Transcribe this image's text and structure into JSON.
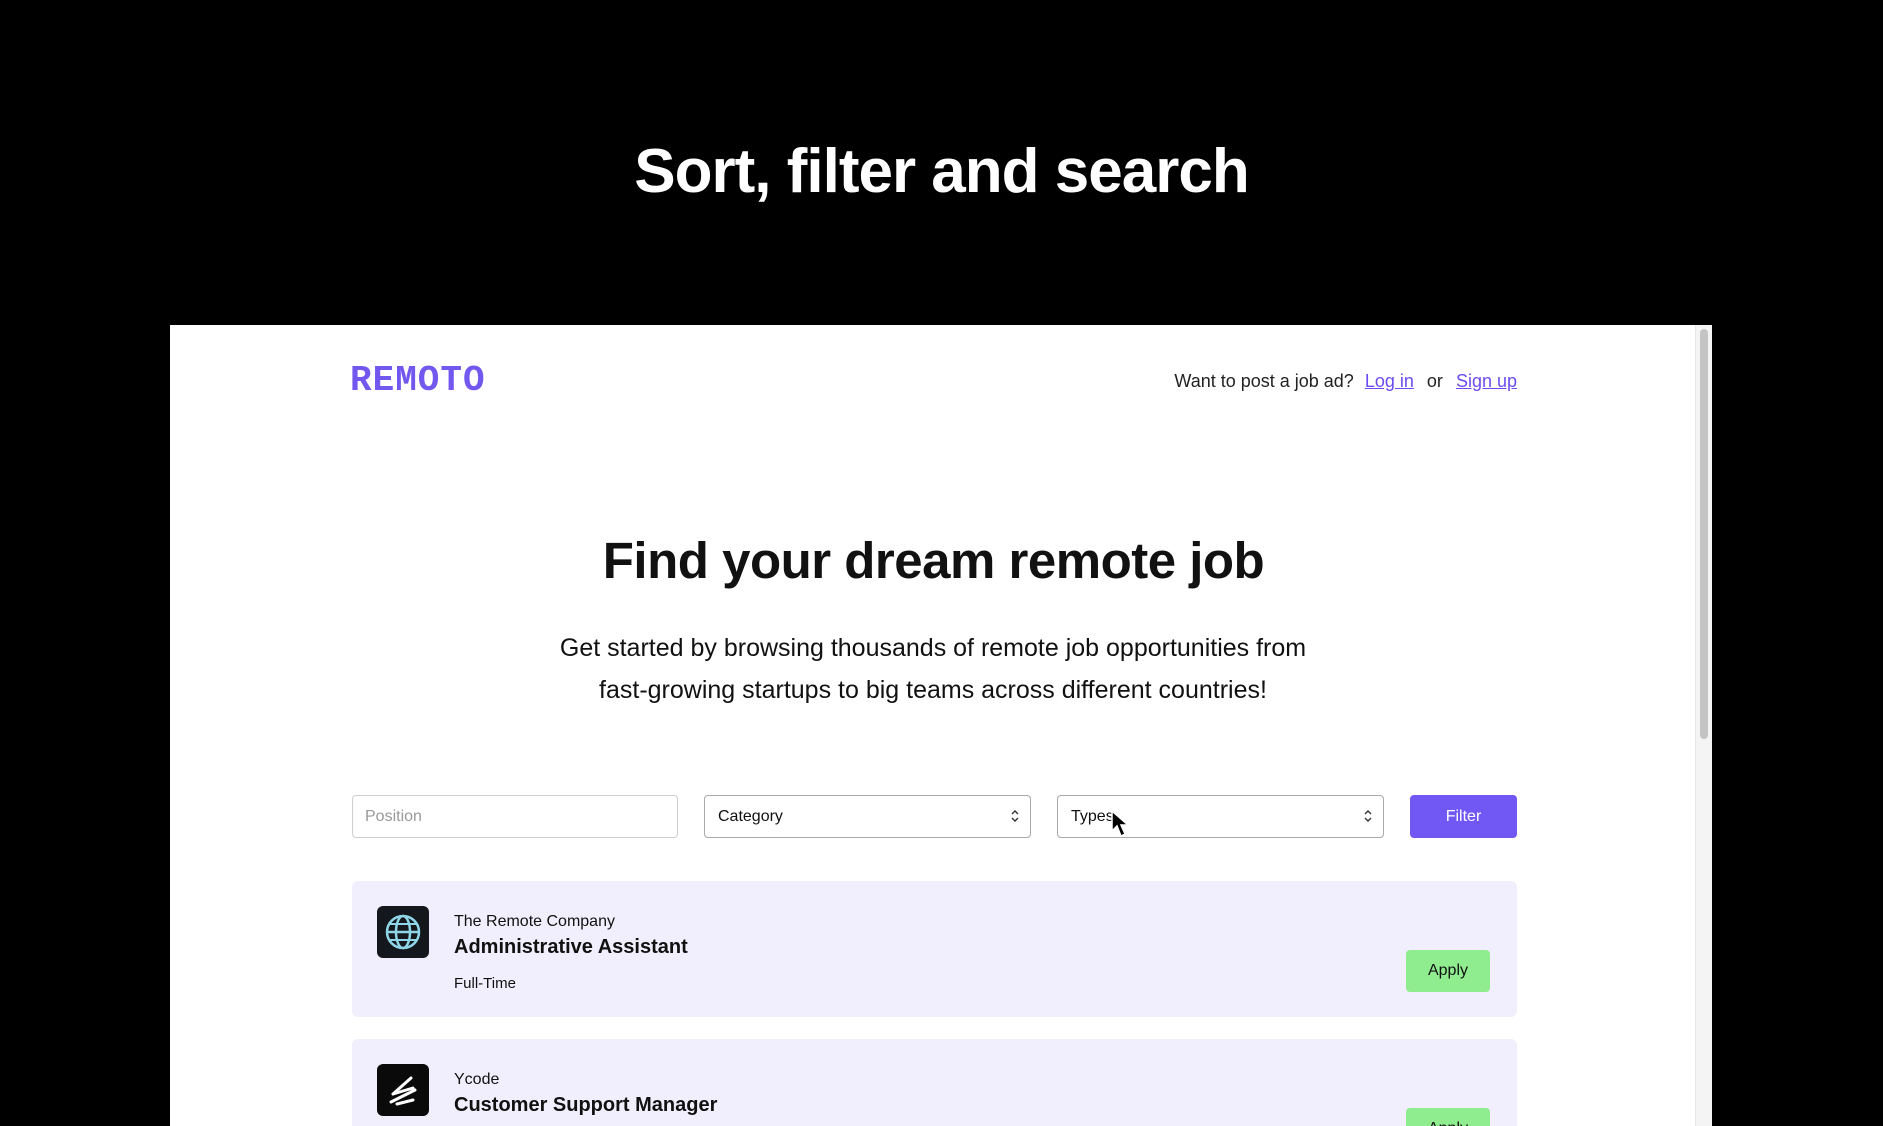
{
  "headline": "Sort, filter and search",
  "site": {
    "logo": "REMOTO",
    "auth_prompt": "Want to post a job ad?",
    "login_label": "Log in",
    "or_label": "or",
    "signup_label": "Sign up"
  },
  "hero": {
    "title": "Find your dream remote job",
    "subtitle": "Get started by browsing thousands of remote job opportunities from fast-growing startups to big teams across different countries!"
  },
  "filters": {
    "position_placeholder": "Position",
    "category_value": "Category",
    "types_value": "Types",
    "filter_label": "Filter"
  },
  "jobs": [
    {
      "company": "The Remote Company",
      "title": "Administrative Assistant",
      "type": "Full-Time",
      "apply_label": "Apply",
      "logo_icon": "globe-icon"
    },
    {
      "company": "Ycode",
      "title": "Customer Support Manager",
      "type": "",
      "apply_label": "Apply",
      "logo_icon": "ycode-logo-icon"
    }
  ],
  "colors": {
    "brand": "#7358f0",
    "filter_button": "#7158f5",
    "job_card": "#f1effd",
    "apply_button": "#8fec8f"
  }
}
